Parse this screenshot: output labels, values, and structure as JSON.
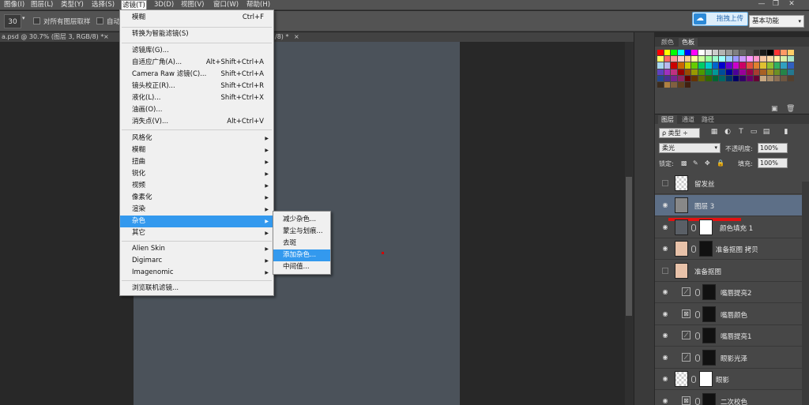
{
  "menubar": {
    "items": [
      "图像(I)",
      "图层(L)",
      "类型(Y)",
      "选择(S)",
      "滤镜(T)",
      "3D(D)",
      "视图(V)",
      "窗口(W)",
      "帮助(H)"
    ],
    "window_controls": [
      "—",
      "❐",
      "✕"
    ]
  },
  "options": {
    "size_value": "30",
    "sample_all_layers": "对所有图层取样",
    "auto_label": "自动",
    "upload_label": "拖拽上传",
    "workspace": "基本功能"
  },
  "tabs": {
    "doc1": "a.psd @ 30.7% (图层 3, RGB/8) *",
    "doc1_close": "×",
    "doc2_fragment": "/8) *",
    "doc2_close": "×"
  },
  "filter_menu": {
    "last_filter": {
      "label": "模糊",
      "shortcut": "Ctrl+F"
    },
    "convert_smart": "转换为智能滤镜(S)",
    "group2": [
      {
        "label": "滤镜库(G)...",
        "shortcut": ""
      },
      {
        "label": "自适应广角(A)...",
        "shortcut": "Alt+Shift+Ctrl+A"
      },
      {
        "label": "Camera Raw 滤镜(C)...",
        "shortcut": "Shift+Ctrl+A"
      },
      {
        "label": "镜头校正(R)...",
        "shortcut": "Shift+Ctrl+R"
      },
      {
        "label": "液化(L)...",
        "shortcut": "Shift+Ctrl+X"
      },
      {
        "label": "油画(O)...",
        "shortcut": ""
      },
      {
        "label": "消失点(V)...",
        "shortcut": "Alt+Ctrl+V"
      }
    ],
    "group3": [
      "风格化",
      "模糊",
      "扭曲",
      "锐化",
      "视频",
      "像素化",
      "渲染",
      "杂色",
      "其它"
    ],
    "group4": [
      "Alien Skin",
      "Digimarc",
      "Imagenomic"
    ],
    "browse_online": "浏览联机滤镜..."
  },
  "noise_submenu": [
    "减少杂色...",
    "蒙尘与划痕...",
    "去斑",
    "添加杂色...",
    "中间值..."
  ],
  "swatches_panel": {
    "tabs": [
      "颜色",
      "色板"
    ],
    "colors": [
      "#ff0000",
      "#ffff00",
      "#00ff00",
      "#00ffff",
      "#0000ff",
      "#ff00ff",
      "#ffffff",
      "#e6e6e6",
      "#cccccc",
      "#b3b3b3",
      "#999999",
      "#808080",
      "#666666",
      "#4d4d4d",
      "#333333",
      "#1a1a1a",
      "#000000",
      "#ff3333",
      "#ff9966",
      "#ffcc66",
      "#ffff66",
      "#ff6666",
      "#ff9999",
      "#ffcccc",
      "#ffcc99",
      "#ffff99",
      "#ccff99",
      "#99ff99",
      "#99ffcc",
      "#99ffff",
      "#99ccff",
      "#9999ff",
      "#cc99ff",
      "#ff99ff",
      "#ff99cc",
      "#f7c6a3",
      "#fcd9a8",
      "#fff1a8",
      "#d7f0a8",
      "#a8e6c8",
      "#a8d8f0",
      "#b8b8f0",
      "#cc0000",
      "#cc6600",
      "#cccc00",
      "#66cc00",
      "#00cc66",
      "#00cccc",
      "#0066cc",
      "#0000cc",
      "#6600cc",
      "#cc00cc",
      "#cc0066",
      "#e05040",
      "#e08030",
      "#e0c030",
      "#90c030",
      "#30b060",
      "#30a0c0",
      "#3060c0",
      "#6040c0",
      "#a030c0",
      "#c03080",
      "#990000",
      "#994c00",
      "#999900",
      "#4c9900",
      "#00994c",
      "#009999",
      "#004c99",
      "#000099",
      "#4c0099",
      "#990099",
      "#99004c",
      "#a83c30",
      "#a86024",
      "#a89024",
      "#6c9024",
      "#248448",
      "#247890",
      "#244890",
      "#483090",
      "#782490",
      "#902460",
      "#660000",
      "#663300",
      "#666600",
      "#336600",
      "#006633",
      "#006666",
      "#003366",
      "#000066",
      "#330066",
      "#660066",
      "#660033",
      "#c8a882",
      "#a88c6a",
      "#8c7054",
      "#6e5640",
      "#54402e",
      "#3c2c1e",
      "#b08040",
      "#806040",
      "#604020",
      "#402010"
    ],
    "footer_icons": [
      "new-swatch-icon",
      "trash-icon"
    ]
  },
  "layers_panel": {
    "tabs": [
      "图层",
      "通道",
      "路径"
    ],
    "filter_kind": "ρ 类型 ÷",
    "blend_mode": "柔光",
    "opacity_label": "不透明度:",
    "opacity_value": "100%",
    "lock_label": "锁定:",
    "fill_label": "填充:",
    "fill_value": "100%",
    "layers": [
      {
        "name": "留发丝",
        "visible": false
      },
      {
        "name": "图层 3",
        "visible": true,
        "selected": true
      },
      {
        "name": "颜色填充 1",
        "visible": true
      },
      {
        "name": "准备抠图 拷贝",
        "visible": true
      },
      {
        "name": "准备抠图",
        "visible": false
      },
      {
        "name": "嘴唇提亮2",
        "visible": true
      },
      {
        "name": "嘴唇颜色",
        "visible": true
      },
      {
        "name": "嘴唇提亮1",
        "visible": true
      },
      {
        "name": "眼影光泽",
        "visible": true
      },
      {
        "name": "眼影",
        "visible": true
      },
      {
        "name": "二次校色",
        "visible": true
      }
    ]
  }
}
